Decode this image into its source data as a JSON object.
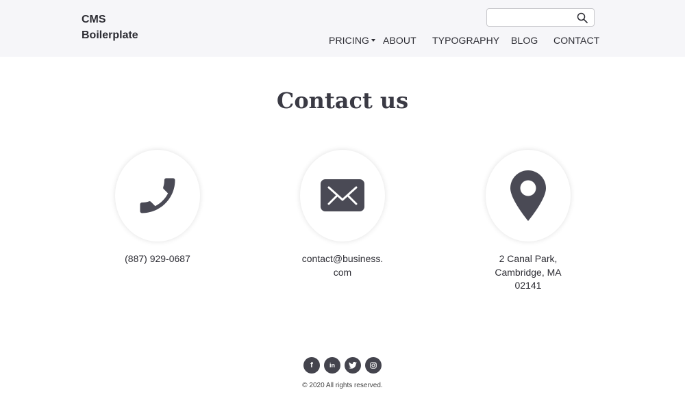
{
  "header": {
    "logo_line1": "CMS",
    "logo_line2": "Boilerplate",
    "search": {
      "value": "",
      "placeholder": ""
    }
  },
  "nav": [
    {
      "label": "PRICING",
      "has_dropdown": true
    },
    {
      "label": "ABOUT"
    },
    {
      "label": "TYPOGRAPHY"
    },
    {
      "label": "BLOG"
    },
    {
      "label": "CONTACT"
    }
  ],
  "main": {
    "title": "Contact us",
    "cards": [
      {
        "icon": "phone-icon",
        "lines": [
          "(887) 929-0687"
        ]
      },
      {
        "icon": "envelope-icon",
        "lines": [
          "contact@business.",
          "com"
        ]
      },
      {
        "icon": "map-pin-icon",
        "lines": [
          "2 Canal Park,",
          "Cambridge, MA",
          "02141"
        ]
      }
    ]
  },
  "footer": {
    "socials": [
      "facebook-icon",
      "linkedin-icon",
      "twitter-icon",
      "instagram-icon"
    ],
    "social_glyphs": [
      "f",
      "in"
    ],
    "copyright": "© 2020 All rights reserved."
  },
  "colors": {
    "header_bg": "#f6f6f9",
    "icon": "#4a4a55",
    "text": "#2c2c33"
  }
}
